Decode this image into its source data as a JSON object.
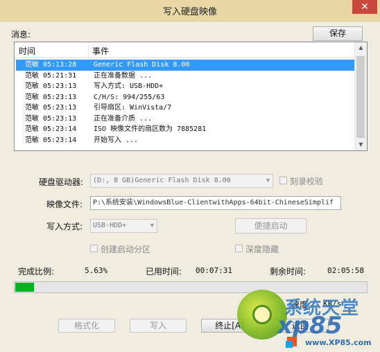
{
  "window": {
    "title": "写入硬盘映像",
    "close_glyph": "✕"
  },
  "messages": {
    "label": "消息:",
    "save_button": "保存",
    "columns": {
      "time": "时间",
      "event": "事件"
    },
    "rows": [
      {
        "time": "范敏  05:13:28",
        "event": "Generic Flash Disk       8.00",
        "selected": true
      },
      {
        "time": "范敏  05:21:31",
        "event": "正在准备数据 ..."
      },
      {
        "time": "范敏  05:23:13",
        "event": "写入方式: USB-HDD+"
      },
      {
        "time": "范敏  05:23:13",
        "event": "C/H/S: 994/255/63"
      },
      {
        "time": "范敏  05:23:13",
        "event": "引导扇区: WinVista/7"
      },
      {
        "time": "范敏  05:23:13",
        "event": "正在准备介质 ..."
      },
      {
        "time": "范敏  05:23:14",
        "event": "ISO 映像文件的扇区数为 7885281"
      },
      {
        "time": "范敏  05:23:14",
        "event": "开始写入 ..."
      }
    ]
  },
  "drive": {
    "label": "硬盘驱动器:",
    "value": "(D:, 8 GB)Generic Flash Disk        8.00",
    "verify_label": "刻录校验"
  },
  "image": {
    "label": "映像文件:",
    "value": "P:\\系统安装\\WindowsBlue-ClientwithApps-64bit-ChineseSimplif"
  },
  "write_mode": {
    "label": "写入方式:",
    "value": "USB-HDD+",
    "quick_boot_button": "便捷启动"
  },
  "options": {
    "create_boot_partition": "创建启动分区",
    "deep_hide": "深度隐藏"
  },
  "stats": {
    "complete_label": "完成比例:",
    "complete_value": "5.63%",
    "used_label": "已用时间:",
    "used_value": "00:07:31",
    "remain_label": "剩余时间:",
    "remain_value": "02:05:58",
    "speed_label": "速度:",
    "speed_value": "KB/s",
    "progress_fraction": 0.0563
  },
  "buttons": {
    "format": "格式化",
    "write": "写入",
    "stop": "终止[A]",
    "back": "返回"
  },
  "watermark": {
    "line1": "系统天堂",
    "line2": "xp85",
    "line3": "www.XP85.com"
  },
  "colors": {
    "progress_fill": "#06b025",
    "selection": "#3399ff",
    "titlebar": "#e9d8a6"
  }
}
